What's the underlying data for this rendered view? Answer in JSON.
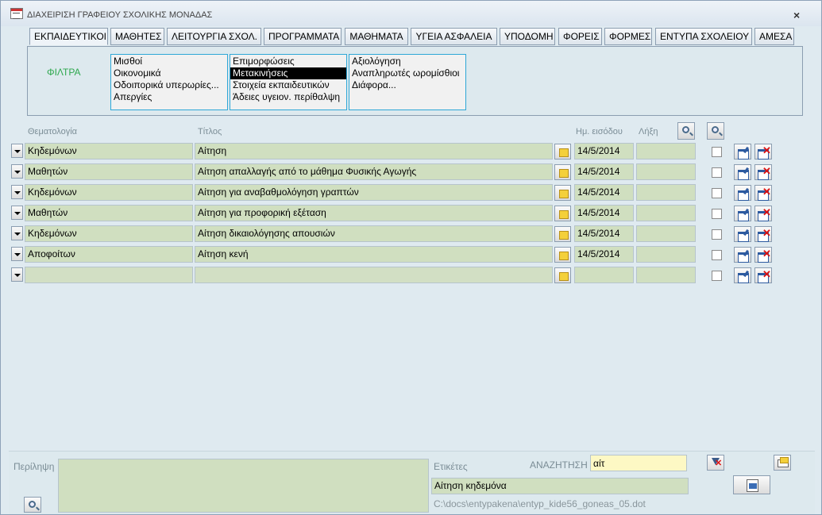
{
  "window": {
    "title": "ΔΙΑΧΕΙΡΙΣΗ  ΓΡΑΦΕΙΟΥ ΣΧΟΛΙΚΗΣ ΜΟΝΑΔΑΣ",
    "close_label": "×"
  },
  "tabs": [
    {
      "label": "ΕΚΠΑΙΔΕΥΤΙΚΟΙ",
      "active": true
    },
    {
      "label": "ΜΑΘΗΤΕΣ"
    },
    {
      "label": "ΛΕΙΤΟΥΡΓΙΑ ΣΧΟΛ."
    },
    {
      "label": "ΠΡΟΓΡΑΜΜΑΤΑ"
    },
    {
      "label": "ΜΑΘΗΜΑΤΑ"
    },
    {
      "label": "ΥΓΕΙΑ ΑΣΦΑΛΕΙΑ"
    },
    {
      "label": "ΥΠΟΔΟΜΗ"
    },
    {
      "label": "ΦΟΡΕΙΣ"
    },
    {
      "label": "ΦΟΡΜΕΣ"
    },
    {
      "label": "ΕΝΤΥΠΑ ΣΧΟΛΕΙΟΥ"
    },
    {
      "label": "ΑΜΕΣΑ"
    }
  ],
  "filters": {
    "label": "ΦΙΛΤΡΑ",
    "lists": [
      [
        "Μισθοί",
        "Οικονομικά",
        "Οδοιπορικά υπερωρίες...",
        "Απεργίες"
      ],
      [
        "Επιμορφώσεις",
        "Μετακινήσεις",
        "Στοιχεία εκπαιδευτικών",
        "Άδειες υγειον. περίθαλψη"
      ],
      [
        "Αξιολόγηση",
        "Αναπληρωτές ωρομίσθιοι",
        "Διάφορα..."
      ]
    ],
    "selected": "Μετακινήσεις"
  },
  "columns": {
    "topic": "Θεματολογία",
    "title": "Τίτλος",
    "entry_date": "Ημ. εισόδου",
    "expiry": "Λήξη"
  },
  "rows": [
    {
      "topic": "Κηδεμόνων",
      "title": "Αίτηση",
      "entry_date": "14/5/2014",
      "expiry": ""
    },
    {
      "topic": "Μαθητών",
      "title": "Αίτηση απαλλαγής από το μάθημα Φυσικής Αγωγής",
      "entry_date": "14/5/2014",
      "expiry": ""
    },
    {
      "topic": "Κηδεμόνων",
      "title": "Αίτηση για αναβαθμολόγηση γραπτών",
      "entry_date": "14/5/2014",
      "expiry": ""
    },
    {
      "topic": "Μαθητών",
      "title": "Αίτηση για προφορική εξέταση",
      "entry_date": "14/5/2014",
      "expiry": ""
    },
    {
      "topic": "Κηδεμόνων",
      "title": "Αίτηση δικαιολόγησης απουσιών",
      "entry_date": "14/5/2014",
      "expiry": ""
    },
    {
      "topic": "Αποφοίτων",
      "title": "Αίτηση κενή",
      "entry_date": "14/5/2014",
      "expiry": ""
    },
    {
      "topic": "",
      "title": "",
      "entry_date": "",
      "expiry": ""
    }
  ],
  "bottom": {
    "summary_label": "Περίληψη",
    "tags_label": "Ετικέτες",
    "search_label": "ΑΝΑΖΗΤΗΣΗ",
    "search_value": "αίτ",
    "tags_value": "Αίτηση κηδεμόνα",
    "file_path": "C:\\docs\\entypakena\\entyp_kide56_goneas_05.dot"
  }
}
